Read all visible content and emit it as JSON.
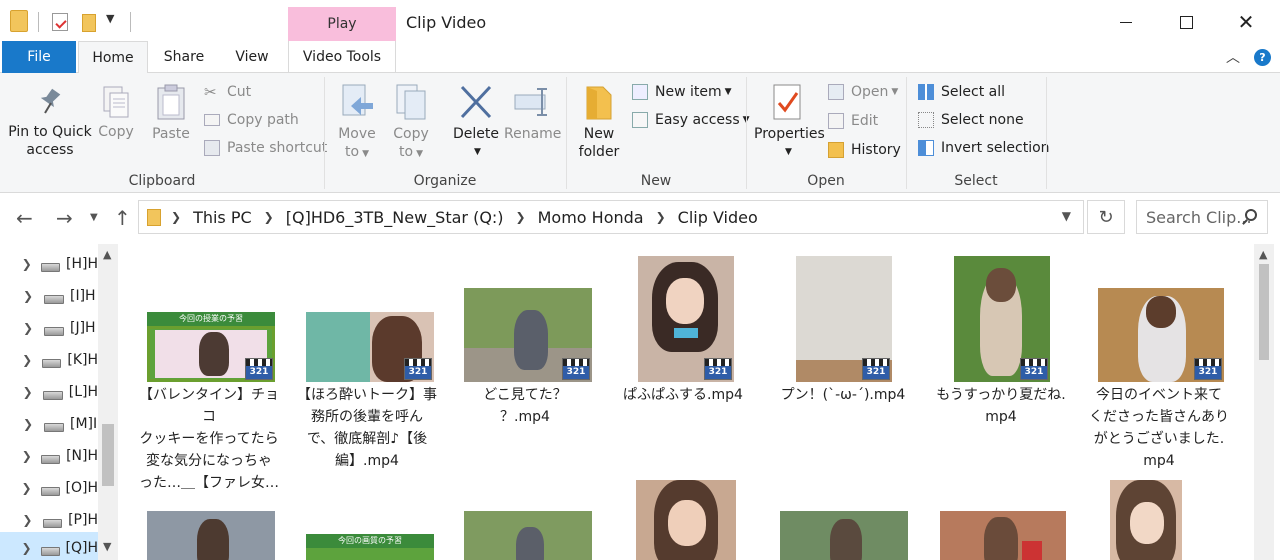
{
  "window": {
    "title": "Clip Video",
    "contextual_tab_header": "Play"
  },
  "tabs": {
    "file": "File",
    "home": "Home",
    "share": "Share",
    "view": "View",
    "video_tools": "Video Tools"
  },
  "ribbon": {
    "clipboard": {
      "label": "Clipboard",
      "pin_line1": "Pin to Quick",
      "pin_line2": "access",
      "copy": "Copy",
      "paste": "Paste",
      "cut": "Cut",
      "copy_path": "Copy path",
      "paste_shortcut": "Paste shortcut"
    },
    "organize": {
      "label": "Organize",
      "move_to_line1": "Move",
      "move_to_line2": "to",
      "copy_to_line1": "Copy",
      "copy_to_line2": "to",
      "delete": "Delete",
      "rename": "Rename"
    },
    "new": {
      "label": "New",
      "new_folder_line1": "New",
      "new_folder_line2": "folder",
      "new_item": "New item",
      "easy_access": "Easy access"
    },
    "open": {
      "label": "Open",
      "properties": "Properties",
      "open": "Open",
      "edit": "Edit",
      "history": "History"
    },
    "select": {
      "label": "Select",
      "select_all": "Select all",
      "select_none": "Select none",
      "invert_selection": "Invert selection"
    }
  },
  "address": {
    "crumbs": [
      "This PC",
      "[Q]HD6_3TB_New_Star (Q:)",
      "Momo Honda",
      "Clip Video"
    ],
    "search_placeholder": "Search Clip..."
  },
  "nav_items": [
    "[H]H",
    "[I]H",
    "[J]H",
    "[K]H",
    "[L]H",
    "[M]I",
    "[N]H",
    "[O]H",
    "[P]H",
    "[Q]H"
  ],
  "files": [
    {
      "name": "【バレンタイン】チョコクッキーを作ってたら変な気分になっちゃった…＿【ファレ女…",
      "lines": [
        "【バレンタイン】チョコ",
        "クッキーを作ってたら",
        "変な気分になっちゃ",
        "った…＿【ファレ女…"
      ],
      "banner": "今回の授業の予習"
    },
    {
      "name": "【ほろ酔いトーク】事務所の後輩を呼んで、徹底解剖♪【後編】.mp4",
      "lines": [
        "【ほろ酔いトーク】事",
        "務所の後輩を呼ん",
        "で、徹底解剖♪【後",
        "編】.mp4"
      ]
    },
    {
      "name": "どこ見てた？？.mp4",
      "lines": [
        "どこ見てた？",
        "？.mp4"
      ]
    },
    {
      "name": "ぱふぱふする.mp4",
      "lines": [
        "ぱふぱふする.mp4"
      ]
    },
    {
      "name": "プン！(`-ω-´).mp4",
      "lines": [
        "プン！(`-ω-´).mp4"
      ]
    },
    {
      "name": "もうすっかり夏だね.mp4",
      "lines": [
        "もうすっかり夏だね.",
        "mp4"
      ]
    },
    {
      "name": "今日のイベント来てくださった皆さんありがとうございました.mp4",
      "lines": [
        "今日のイベント来て",
        "くださった皆さんあり",
        "がとうございました.",
        "mp4"
      ]
    }
  ],
  "second_row_banner": "今回の画質の予習",
  "badge_text": "321",
  "colors": {
    "accent": "#1979ca",
    "play_tab": "#f9bedc",
    "selection": "#cce8ff"
  }
}
